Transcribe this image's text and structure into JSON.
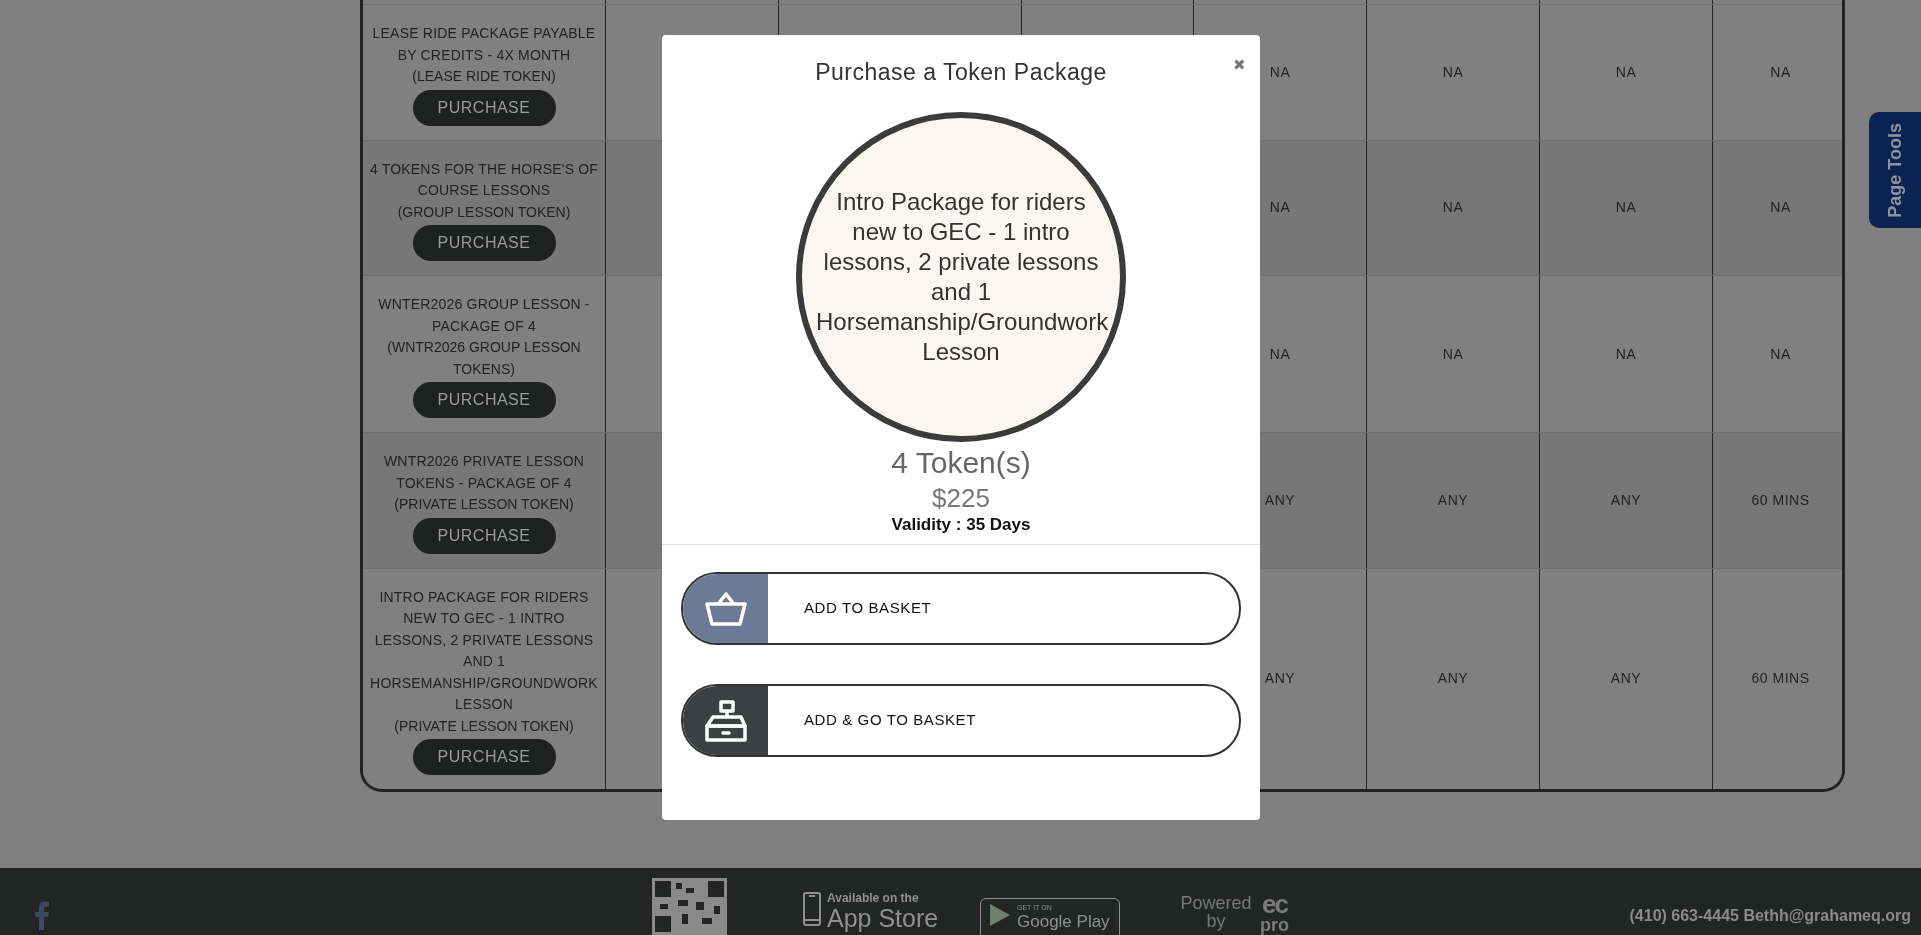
{
  "table": {
    "rows": [
      {
        "package": "LEASE RIDE PACKAGE PAYABLE BY CREDITS - 4X MONTH",
        "token": "(LEASE RIDE TOKEN)",
        "button": "PURCHASE",
        "cells": [
          "NA",
          "NA",
          "NA",
          "NA"
        ]
      },
      {
        "package": "4 TOKENS FOR THE HORSE'S OF COURSE LESSONS",
        "token": "(GROUP LESSON TOKEN)",
        "button": "PURCHASE",
        "cells": [
          "NA",
          "NA",
          "NA",
          "NA"
        ]
      },
      {
        "package": "WNTER2026 GROUP LESSON - PACKAGE OF 4",
        "token": "(WNTR2026 GROUP LESSON TOKENS)",
        "button": "PURCHASE",
        "cells": [
          "NA",
          "NA",
          "NA",
          "NA"
        ]
      },
      {
        "package": "WNTR2026 PRIVATE LESSON TOKENS - PACKAGE OF 4",
        "token": "(PRIVATE LESSON TOKEN)",
        "button": "PURCHASE",
        "cells": [
          "ANY",
          "ANY",
          "ANY",
          "60 MINS"
        ]
      },
      {
        "package": "INTRO PACKAGE FOR RIDERS NEW TO GEC - 1 INTRO LESSONS, 2 PRIVATE LESSONS AND 1 HORSEMANSHIP/GROUNDWORK LESSON",
        "token": "(PRIVATE LESSON TOKEN)",
        "button": "PURCHASE",
        "cells": [
          "ANY",
          "ANY",
          "ANY",
          "60 MINS"
        ]
      }
    ]
  },
  "modal": {
    "title": "Purchase a Token Package",
    "close": "✖",
    "package_name": "Intro Package for riders new to GEC - 1 intro lessons, 2 private lessons and 1 Horsemanship/Groundwork Lesson",
    "tokens": "4 Token(s)",
    "price": "$225",
    "validity": "Validity : 35 Days",
    "actions": [
      {
        "kind": "basket",
        "label": "ADD TO BASKET",
        "color": "#6c7a96"
      },
      {
        "kind": "register",
        "label": "ADD & GO TO BASKET",
        "color": "#3d4040"
      }
    ]
  },
  "page_tools": "Page Tools",
  "footer": {
    "app_store": {
      "small": "Available on the",
      "big": "App Store"
    },
    "google_play": {
      "small": "GET IT ON",
      "big": "Google Play"
    },
    "powered_by": "Powered by",
    "logo": {
      "top": "ec",
      "bottom": "pro"
    },
    "contact": "(410) 663-4445 Bethh@grahameq.org"
  }
}
